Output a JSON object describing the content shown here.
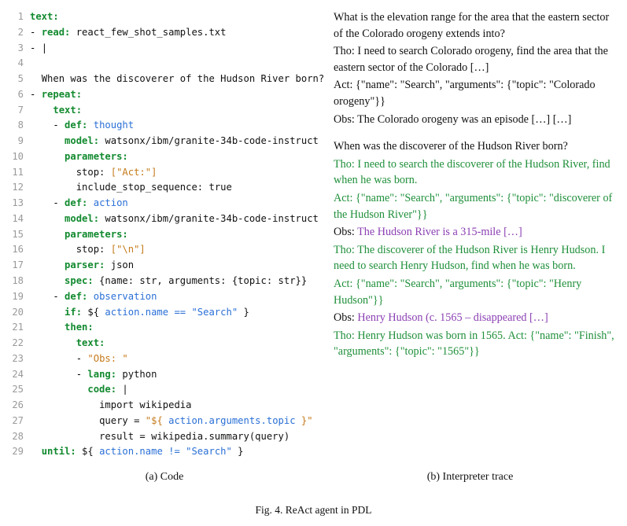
{
  "code": {
    "l1": {
      "ln": "1",
      "key": "text:"
    },
    "l2": {
      "ln": "2",
      "dash": "- ",
      "key": "read:",
      "val": " react_few_shot_samples.txt"
    },
    "l3": {
      "ln": "3",
      "dash": "- ",
      "val": "|"
    },
    "l4": {
      "ln": "4"
    },
    "l5": {
      "ln": "5",
      "txt": "When was the discoverer of the Hudson River born?"
    },
    "l6": {
      "ln": "6",
      "dash": "- ",
      "key": "repeat:"
    },
    "l7": {
      "ln": "7",
      "key": "text:"
    },
    "l8": {
      "ln": "8",
      "dash": "- ",
      "key": "def:",
      "var": " thought"
    },
    "l9": {
      "ln": "9",
      "key": "model:",
      "val": " watsonx/ibm/granite-34b-code-instruct"
    },
    "l10": {
      "ln": "10",
      "key": "parameters:"
    },
    "l11": {
      "ln": "11",
      "k2": "stop:",
      "val": " [\"Act:\"]"
    },
    "l12": {
      "ln": "12",
      "k2": "include_stop_sequence:",
      "val": " true"
    },
    "l13": {
      "ln": "13",
      "dash": "- ",
      "key": "def:",
      "var": " action"
    },
    "l14": {
      "ln": "14",
      "key": "model:",
      "val": " watsonx/ibm/granite-34b-code-instruct"
    },
    "l15": {
      "ln": "15",
      "key": "parameters:"
    },
    "l16": {
      "ln": "16",
      "k2": "stop:",
      "val": " [\"\\n\"]"
    },
    "l17": {
      "ln": "17",
      "key": "parser:",
      "val": " json"
    },
    "l18": {
      "ln": "18",
      "key": "spec:",
      "val": " {name: str, arguments: {topic: str}}"
    },
    "l19": {
      "ln": "19",
      "dash": "- ",
      "key": "def:",
      "var": " observation"
    },
    "l20": {
      "ln": "20",
      "key": "if:",
      "d1": " ${",
      "expr": " action.name == \"Search\" ",
      "d2": "}"
    },
    "l21": {
      "ln": "21",
      "key": "then:"
    },
    "l22": {
      "ln": "22",
      "key": "text:"
    },
    "l23": {
      "ln": "23",
      "dash": "- ",
      "val": "\"Obs: \""
    },
    "l24": {
      "ln": "24",
      "dash": "- ",
      "key": "lang:",
      "val": " python"
    },
    "l25": {
      "ln": "25",
      "key": "code:",
      "val": " |"
    },
    "l26": {
      "ln": "26",
      "val": "import wikipedia"
    },
    "l27": {
      "ln": "27",
      "v1": "query = ",
      "s1": "\"${ ",
      "expr": "action.arguments.topic",
      "s2": " }\""
    },
    "l28": {
      "ln": "28",
      "val": "result = wikipedia.summary(query)"
    },
    "l29": {
      "ln": "29",
      "key": "until:",
      "d1": " ${",
      "expr": " action.name != \"Search\" ",
      "d2": "}"
    }
  },
  "trace": {
    "ex1_q": "What is the elevation range for the area that the eastern sector of the Colorado orogeny extends into?",
    "ex1_tho": "Tho: I need to search Colorado orogeny, find the area that the eastern sector of the Colorado […]",
    "ex1_act": "Act: {\"name\": \"Search\", \"arguments\": {\"topic\": \"Colorado orogeny\"}}",
    "ex1_obs": "Obs: The Colorado orogeny was an episode […] […]",
    "q": "When was the discoverer of the Hudson River born?",
    "tho1_pre": "Tho: ",
    "tho1": "I need to search the discoverer of the Hudson River, find when he was born.",
    "act1": "Act: {\"name\": \"Search\", \"arguments\": {\"topic\": \"discoverer of the Hudson River\"}}",
    "obs1_pre": "Obs: ",
    "obs1": "The Hudson River is a 315-mile […]",
    "tho2": "Tho: The discoverer of the Hudson River is Henry Hudson. I need to search Henry Hudson, find when he was born.",
    "act2": "Act: {\"name\": \"Search\", \"arguments\": {\"topic\": \"Henry Hudson\"}}",
    "obs2_pre": "Obs: ",
    "obs2": "Henry Hudson (c. 1565 – disappeared […]",
    "tho3": "Tho: Henry Hudson was born in 1565. Act: {\"name\": \"Finish\", \"arguments\": {\"topic\": \"1565\"}}"
  },
  "captions": {
    "a": "(a) Code",
    "b": "(b) Interpreter trace"
  },
  "figure": "Fig. 4.  ReAct agent in PDL"
}
